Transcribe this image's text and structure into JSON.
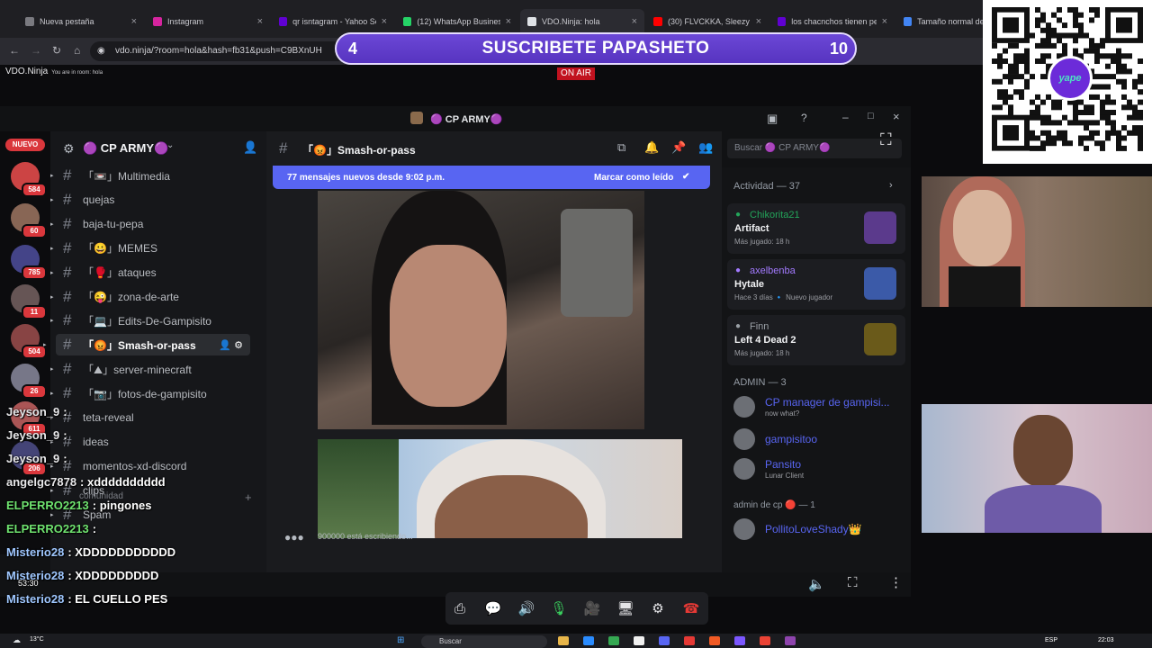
{
  "browser": {
    "tabs": [
      {
        "label": "Nueva pestaña",
        "color": "#7a7a80"
      },
      {
        "label": "Instagram",
        "color": "#d6249f"
      },
      {
        "label": "qr isntagram - Yahoo Sea",
        "color": "#6001d2"
      },
      {
        "label": "(12) WhatsApp Business",
        "color": "#25d366"
      },
      {
        "label": "VDO.Ninja: hola",
        "color": "#dfe2e6"
      },
      {
        "label": "(30) FLVCKKA, Sleezy",
        "color": "#ff0000"
      },
      {
        "label": "los chacnchos tienen pen",
        "color": "#6001d2"
      },
      {
        "label": "Tamaño normal del p",
        "color": "#4285f4"
      }
    ],
    "url": "vdo.ninja/?room=hola&hash=fb31&push=C9BXnUH"
  },
  "overlay": {
    "left_count": "4",
    "banner_text": "SUSCRIBETE PAPASHETO",
    "right_count": "10",
    "on_air": "ON AIR",
    "vdo_title": "VDO.Ninja",
    "vdo_room": "You are in room: hola"
  },
  "discord": {
    "window_title": "🟣 CP ARMY🟣",
    "server_name": "🟣 CP ARMY🟣",
    "new_label": "NUEVO",
    "server_badges": [
      "584",
      "60",
      "785",
      "11",
      "504",
      "26",
      "611",
      "206"
    ],
    "channels": [
      "「📼」Multimedia",
      "quejas",
      "baja-tu-pepa",
      "「😀」MEMES",
      "「🥊」ataques",
      "「😜」zona-de-arte",
      "「💻」Edits-De-Gampisito",
      "「😡」Smash-or-pass",
      "「⛰」server-minecraft",
      "「📷」fotos-de-gampisito",
      "teta-reveal",
      "ideas",
      "momentos-xd-discord",
      "clips",
      "Spam"
    ],
    "category_label": "comunidad",
    "channel_header": "「😡」Smash-or-pass",
    "new_messages_banner": "77 mensajes nuevos desde 9:02 p.m.",
    "mark_read": "Marcar como leído",
    "search_placeholder": "Buscar 🟣 CP ARMY🟣",
    "typing": "900000 está escribiendo...",
    "activity_header": "Actividad — 37",
    "activity": [
      {
        "user": "Chikorita21",
        "game": "Artifact",
        "meta": "Más jugado: 18 h",
        "color": "#23a55a"
      },
      {
        "user": "axelbenba",
        "game": "Hytale",
        "meta": "Hace 3 días  🔹 Nuevo jugador",
        "color": "#a37aff"
      },
      {
        "user": "Finn",
        "game": "Left 4 Dead 2",
        "meta": "Más jugado: 18 h",
        "color": "#9aa0a6"
      }
    ],
    "admin_header": "ADMIN — 3",
    "admins": [
      {
        "name": "CP manager de gampisi...",
        "status": "now what?",
        "color": "#5865f2"
      },
      {
        "name": "gampisitoo",
        "status": "",
        "color": "#5865f2"
      },
      {
        "name": "Pansito",
        "status": "Lunar Client",
        "color": "#5865f2"
      }
    ],
    "admin_cp_header": "admin de cp 🔴 — 1",
    "admin_cp_member": {
      "name": "PollitoLoveShady👑",
      "color": "#5865f2"
    }
  },
  "stream_chat": [
    {
      "user": "Jeyson_9",
      "text": ":",
      "color": "#e8e8ea"
    },
    {
      "user": "Jeyson_9",
      "text": ":",
      "color": "#e8e8ea"
    },
    {
      "user": "Jeyson_9",
      "text": ":",
      "color": "#e8e8ea"
    },
    {
      "user": "angelgc7878",
      "text": ": xdddddddddd",
      "color": "#e8e8ea"
    },
    {
      "user": "ELPERRO2213",
      "text": ": pingones",
      "color": "#6fe36f"
    },
    {
      "user": "ELPERRO2213",
      "text": ":",
      "color": "#6fe36f"
    },
    {
      "user": "Misterio28",
      "text": ": XDDDDDDDDDDD",
      "color": "#9fc7ff"
    },
    {
      "user": "Misterio28",
      "text": ": XDDDDDDDDD",
      "color": "#9fc7ff"
    },
    {
      "user": "Misterio28",
      "text": ": EL CUELLO PES",
      "color": "#9fc7ff"
    }
  ],
  "stream_timer": "53:30",
  "taskbar": {
    "weather": "13°C",
    "search": "Buscar",
    "lang": "ESP",
    "time": "22:03"
  }
}
